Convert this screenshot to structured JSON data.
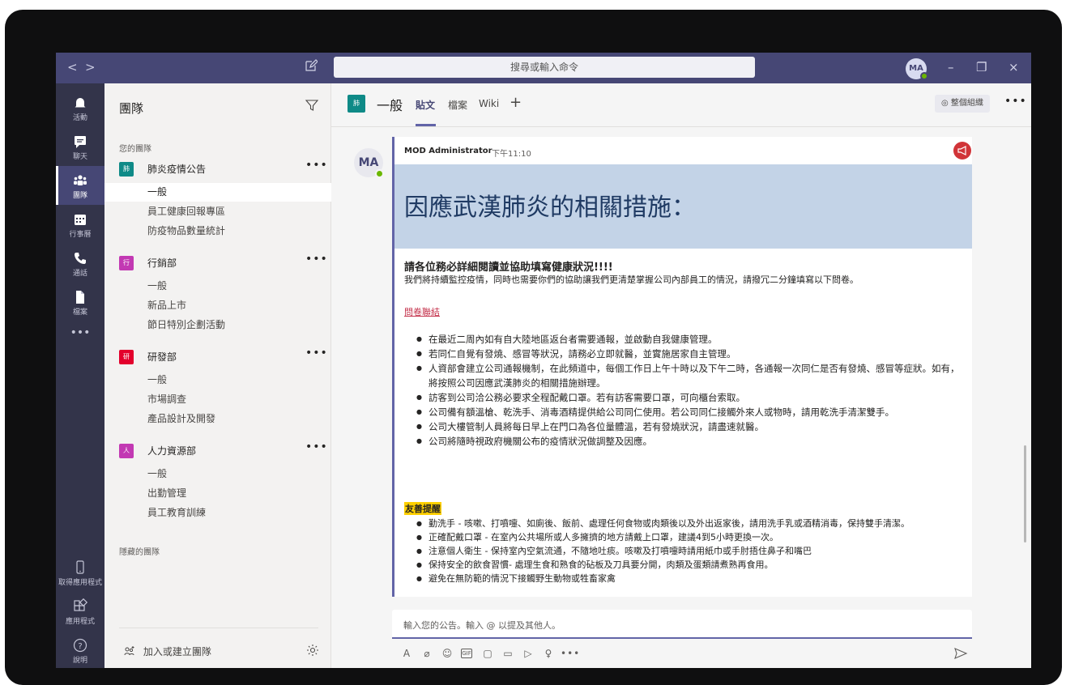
{
  "titlebar": {
    "back": "<",
    "forward": ">",
    "search_placeholder": "搜尋或輸入命令",
    "avatar_initials": "MA",
    "minimize": "–",
    "restore": "❐",
    "close": "×"
  },
  "rail": {
    "activity": "活動",
    "chat": "聊天",
    "teams": "團隊",
    "calendar": "行事曆",
    "calls": "通話",
    "files": "檔案",
    "more": "•••",
    "get_app": "取得應用程式",
    "apps": "應用程式",
    "help": "說明"
  },
  "teams_panel": {
    "title": "團隊",
    "your_teams": "您的團隊",
    "hidden_teams": "隱藏的團隊",
    "add_team": "加入或建立團隊",
    "more": "•••",
    "teams": [
      {
        "avatar": "肺",
        "name": "肺炎疫情公告",
        "color": "#0f8a87",
        "channels": [
          "一般",
          "員工健康回報專區",
          "防疫物品數量統計"
        ]
      },
      {
        "avatar": "行",
        "name": "行銷部",
        "color": "#c239b3",
        "channels": [
          "一般",
          "新品上市",
          "節日特別企劃活動"
        ]
      },
      {
        "avatar": "研",
        "name": "研發部",
        "color": "#e3002c",
        "channels": [
          "一般",
          "市場調查",
          "產品設計及開發"
        ]
      },
      {
        "avatar": "人",
        "name": "人力資源部",
        "color": "#c239b3",
        "channels": [
          "一般",
          "出勤管理",
          "員工教育訓練"
        ]
      }
    ]
  },
  "channel_header": {
    "avatar": "肺",
    "title": "一般",
    "tabs": [
      "貼文",
      "檔案",
      "Wiki",
      "+"
    ],
    "org_button": "整個組織",
    "more": "•••"
  },
  "post": {
    "avatar": "MA",
    "author": "MOD Administrator",
    "time": "下午11:10",
    "banner_title": "因應武漢肺炎的相關措施：",
    "subhead": "請各位務必詳細閱讀並協助填寫健康狀況!!!!",
    "intro": "我們將持續監控疫情，同時也需要你們的協助讓我們更清楚掌握公司內部員工的情況，請撥冗二分鐘填寫以下問卷。",
    "link": "問卷聯結",
    "bullets": [
      "在最近二周內如有自大陸地區返台者需要通報，並啟動自我健康管理。",
      "若同仁自覺有發燒、感冒等狀況，請務必立即就醫，並實施居家自主管理。",
      "人資部會建立公司通報機制，在此頻道中，每個工作日上午十時以及下午二時，各通報一次同仁是否有發燒、感冒等症狀。如有，將按照公司因應武漢肺炎的相關措施辦理。",
      "訪客到公司洽公務必要求全程配戴口罩。若有訪客需要口罩，可向櫃台索取。",
      "公司備有額溫槍、乾洗手、消毒酒精提供給公司同仁使用。若公司同仁接觸外來人或物時，請用乾洗手清潔雙手。",
      "公司大樓管制人員將每日早上在門口為各位量體溫，若有發燒狀況，請盡速就醫。",
      "公司將隨時視政府機關公布的疫情狀況做調整及因應。"
    ],
    "tip_head": "友善提醒",
    "tips": [
      "勤洗手 - 咳嗽、打噴嚏、如廁後、飯前、處理任何食物或肉類後以及外出返家後，請用洗手乳或酒精消毒，保持雙手清潔。",
      "正確配戴口罩 - 在室內公共場所或人多擁擠的地方請戴上口罩，建議4到5小時更換一次。",
      "注意個人衛生 - 保持室內空氣流通，不隨地吐痰。咳嗽及打噴嚏時請用紙巾或手肘捂住鼻子和嘴巴",
      "保持安全的飲食習慣- 處理生食和熟食的砧板及刀具要分開，肉類及蛋類請煮熟再食用。",
      "避免在無防範的情況下接觸野生動物或牲畜家禽"
    ]
  },
  "compose": {
    "placeholder": "輸入您的公告。輸入 @ 以提及其他人。",
    "more": "•••"
  }
}
